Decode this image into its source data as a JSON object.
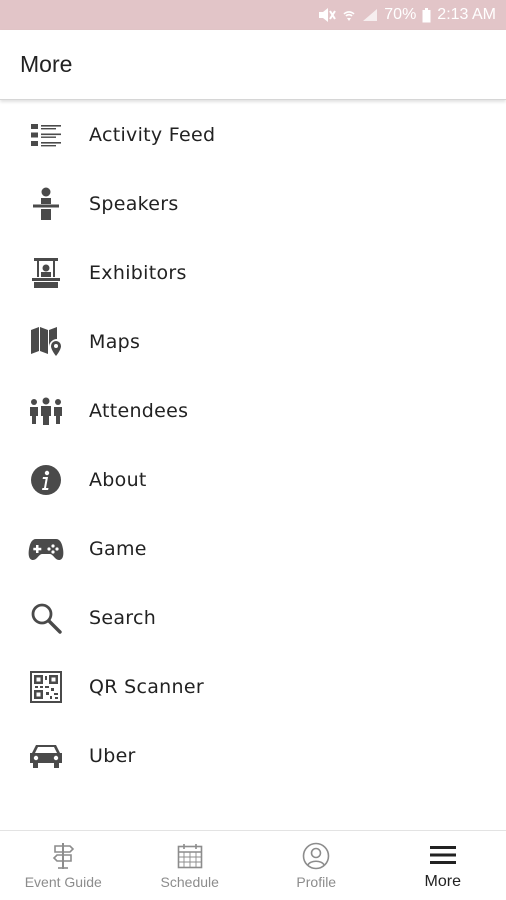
{
  "status_bar": {
    "battery": "70%",
    "time": "2:13 AM",
    "icons": [
      "mute-icon",
      "wifi-icon",
      "signal-icon",
      "battery-icon"
    ]
  },
  "header": {
    "title": "More"
  },
  "menu": {
    "items": [
      {
        "label": "Activity Feed",
        "icon": "activity-feed-icon"
      },
      {
        "label": "Speakers",
        "icon": "speaker-icon"
      },
      {
        "label": "Exhibitors",
        "icon": "exhibitor-booth-icon"
      },
      {
        "label": "Maps",
        "icon": "map-pin-icon"
      },
      {
        "label": "Attendees",
        "icon": "people-group-icon"
      },
      {
        "label": "About",
        "icon": "info-icon"
      },
      {
        "label": "Game",
        "icon": "gamepad-icon"
      },
      {
        "label": "Search",
        "icon": "search-icon"
      },
      {
        "label": "QR Scanner",
        "icon": "qr-code-icon"
      },
      {
        "label": "Uber",
        "icon": "car-icon"
      }
    ]
  },
  "bottom_nav": {
    "items": [
      {
        "label": "Event Guide",
        "icon": "signpost-icon",
        "active": false
      },
      {
        "label": "Schedule",
        "icon": "calendar-icon",
        "active": false
      },
      {
        "label": "Profile",
        "icon": "profile-icon",
        "active": false
      },
      {
        "label": "More",
        "icon": "hamburger-menu-icon",
        "active": true
      }
    ]
  },
  "colors": {
    "status_bar_bg": "#e2c5c8",
    "icon": "#4a4a4a",
    "inactive_nav": "#8c8c8c",
    "active_nav": "#222222"
  }
}
